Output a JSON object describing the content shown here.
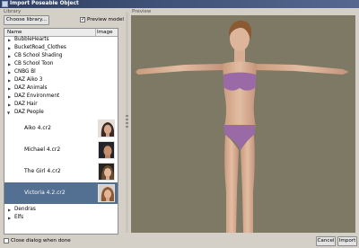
{
  "window": {
    "title": "Import Poseable Object"
  },
  "library": {
    "label": "Library",
    "choose_button": "Choose library...",
    "preview_model_label": "Preview model",
    "preview_model_checked": true,
    "columns": {
      "name": "Name",
      "image": "Image"
    },
    "folders_top": [
      "BubbleHearts",
      "BucketRoad_Clothes",
      "CB School Shading",
      "CB School Toon",
      "CNBG Bl",
      "DAZ Aiko 3",
      "DAZ Animals",
      "DAZ Environment",
      "DAZ Hair"
    ],
    "expanded_folder": "DAZ People",
    "files": [
      {
        "name": "Aiko 4.cr2",
        "selected": false
      },
      {
        "name": "Michael 4.cr2",
        "selected": false
      },
      {
        "name": "The Girl 4.cr2",
        "selected": false
      },
      {
        "name": "Victoria 4.2.cr2",
        "selected": true
      }
    ],
    "folders_bottom": [
      "Dendras",
      "Elfs"
    ]
  },
  "preview": {
    "label": "Preview"
  },
  "footer": {
    "close_when_done_label": "Close dialog when done",
    "close_when_done_checked": false,
    "cancel_button": "Cancel",
    "import_button": "Import"
  },
  "colors": {
    "titlebar": "#3b4d74",
    "selection": "#536f91",
    "viewport_bg": "#7e7964",
    "swimsuit": "#9a6aa6"
  }
}
